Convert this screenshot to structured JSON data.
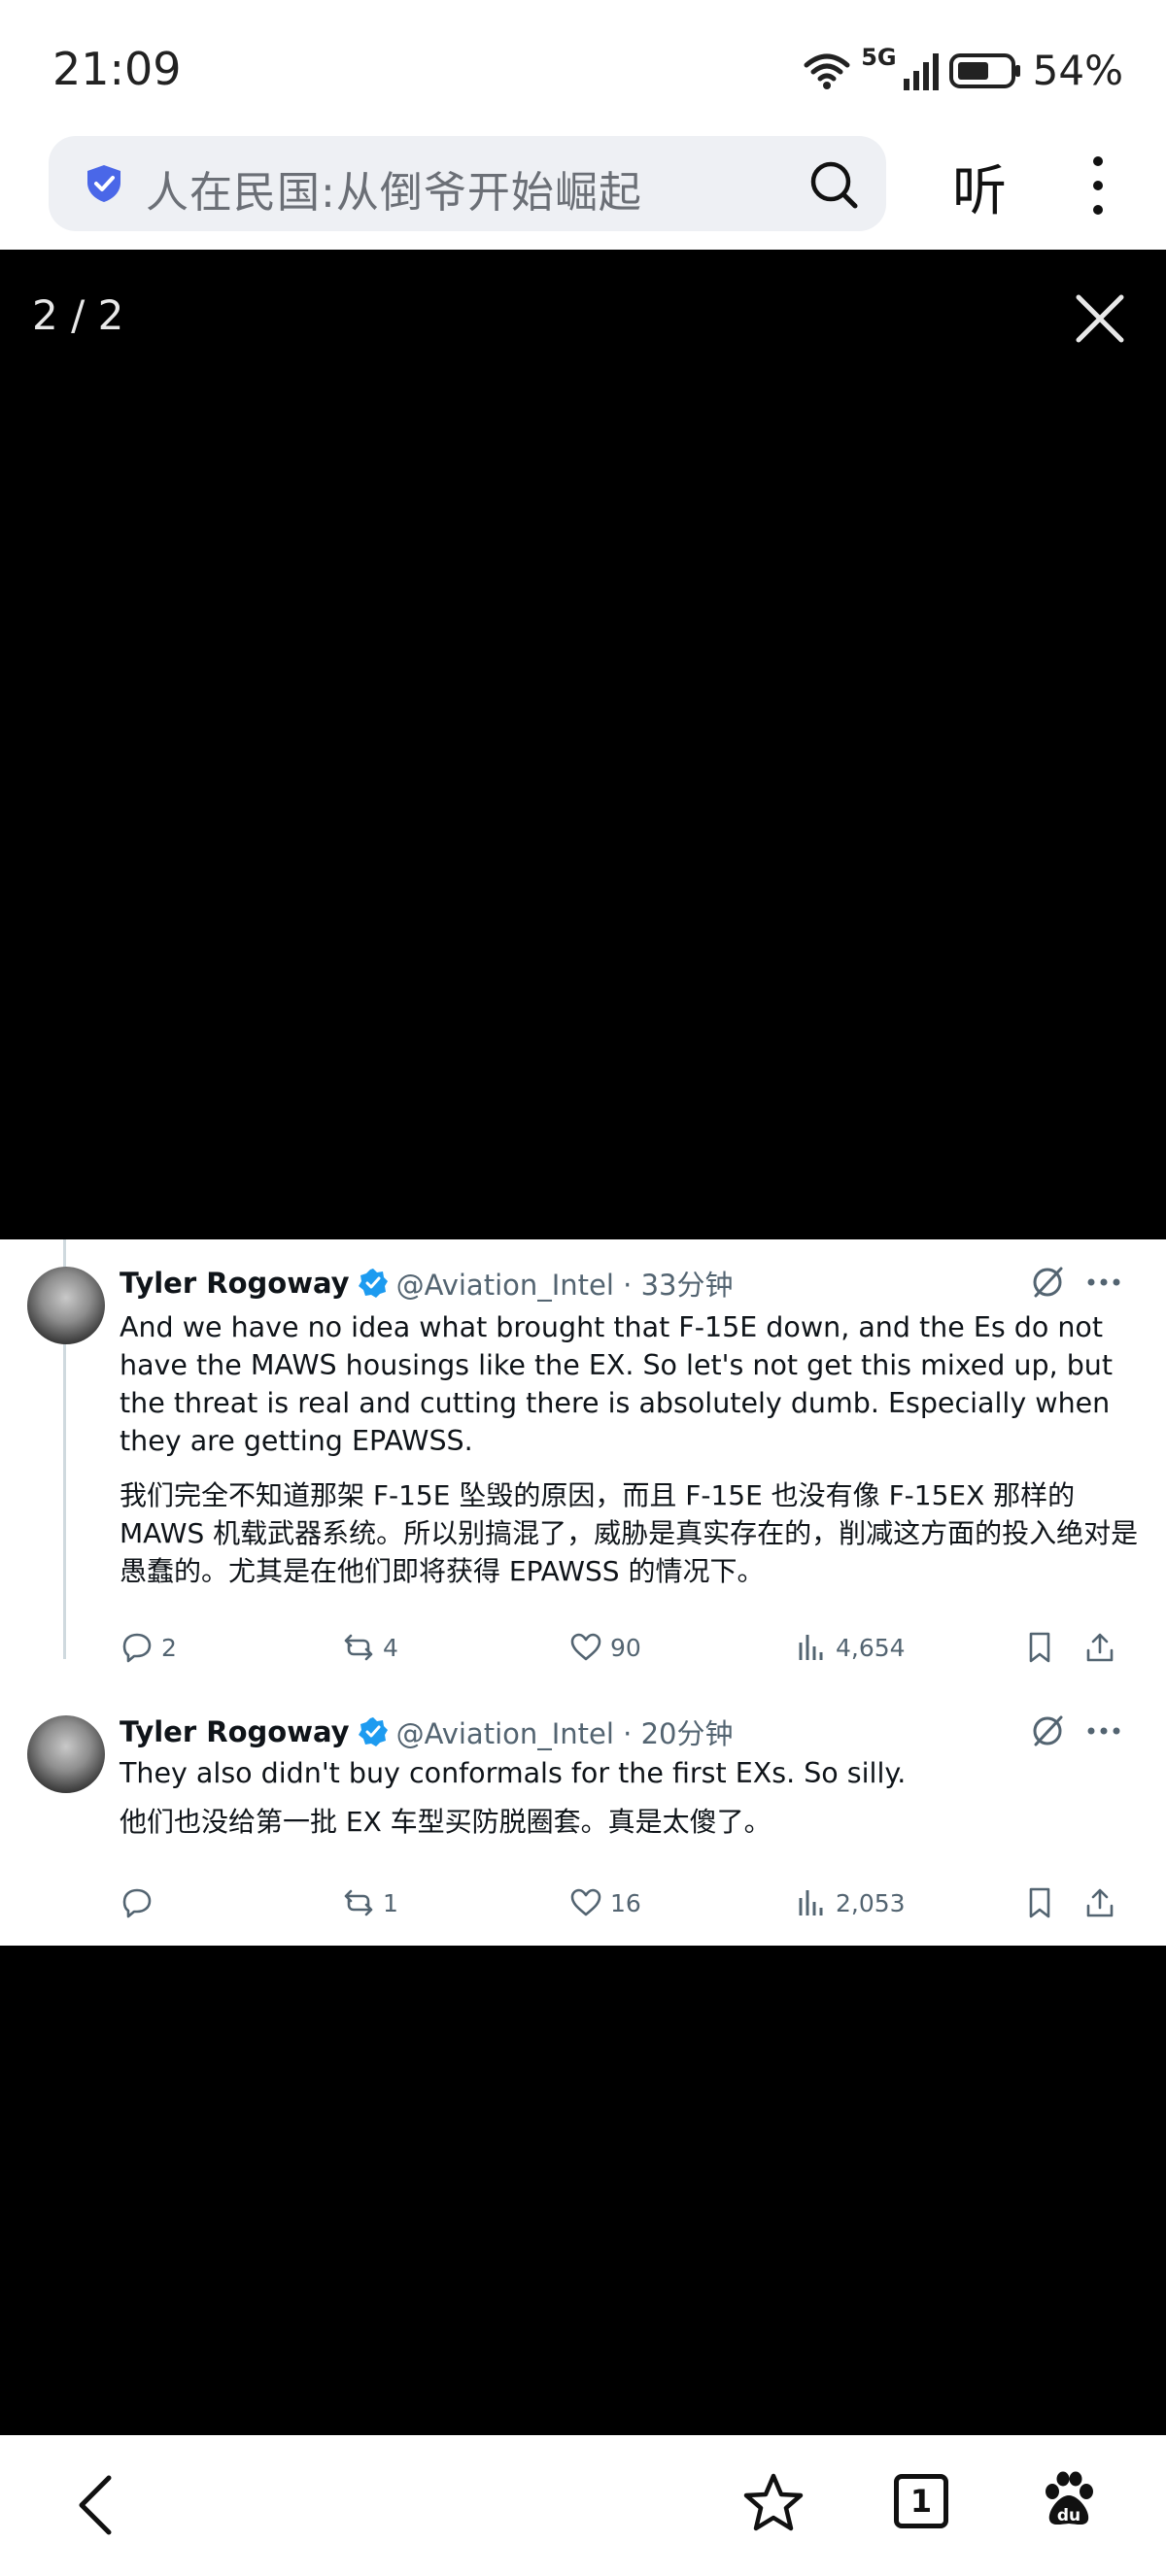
{
  "status": {
    "time": "21:09",
    "network": "5G",
    "battery": "54%"
  },
  "browser": {
    "search_text": "人在民国:从倒爷开始崛起",
    "listen_label": "听",
    "tab_count": "1"
  },
  "viewer": {
    "page_counter": "2 / 2"
  },
  "tweets": [
    {
      "name": "Tyler Rogoway",
      "handle_time": "@Aviation_Intel · 33分钟",
      "text": "And we have no idea what brought that F-15E down, and the Es do not have the MAWS housings like the EX. So let's not get this mixed up, but the threat is real and cutting there is absolutely dumb. Especially when they are getting EPAWSS.",
      "translation": "我们完全不知道那架 F-15E 坠毁的原因，而且 F-15E 也没有像 F-15EX 那样的 MAWS 机载武器系统。所以别搞混了，威胁是真实存在的，削减这方面的投入绝对是愚蠢的。尤其是在他们即将获得 EPAWSS 的情况下。",
      "replies": "2",
      "reposts": "4",
      "likes": "90",
      "views": "4,654"
    },
    {
      "name": "Tyler Rogoway",
      "handle_time": "@Aviation_Intel · 20分钟",
      "text": "They also didn't buy conformals for the first EXs. So silly.",
      "translation": "他们也没给第一批 EX 车型买防脱圈套。真是太傻了。",
      "replies": "",
      "reposts": "1",
      "likes": "16",
      "views": "2,053"
    }
  ],
  "icons": {
    "wifi": "wifi-icon",
    "signal": "signal-icon",
    "battery": "battery-icon",
    "shield": "shield-icon",
    "search": "search-icon",
    "more": "more-vertical-icon",
    "close": "close-icon",
    "back": "back-icon",
    "star": "star-icon",
    "tabs": "tabs-icon",
    "baidu": "baidu-paw-icon"
  },
  "colors": {
    "verified": "#1d9bf0",
    "shield": "#4a67e8",
    "secondary_text": "#536471"
  }
}
